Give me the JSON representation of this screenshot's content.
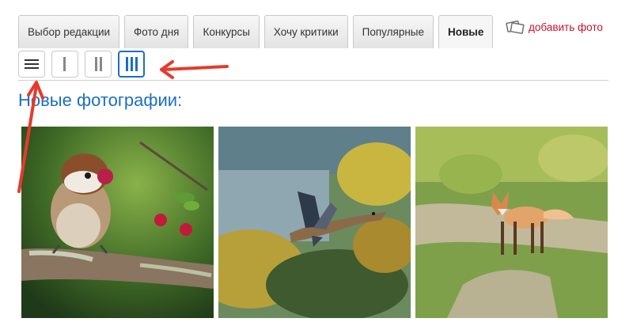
{
  "tabs": [
    {
      "label": "Выбор редакции",
      "active": false
    },
    {
      "label": "Фото дня",
      "active": false
    },
    {
      "label": "Конкурсы",
      "active": false
    },
    {
      "label": "Хочу критики",
      "active": false
    },
    {
      "label": "Популярные",
      "active": false
    },
    {
      "label": "Новые",
      "active": true
    }
  ],
  "add_photo": {
    "label": "добавить фото",
    "icon": "add-photo-icon",
    "color": "#c8102e"
  },
  "view_modes": [
    {
      "icon": "list-view-icon",
      "active": false
    },
    {
      "icon": "one-column-icon",
      "active": false
    },
    {
      "icon": "two-column-icon",
      "active": false
    },
    {
      "icon": "three-column-icon",
      "active": true
    }
  ],
  "section": {
    "title": "Новые фотографии:"
  },
  "photos": [
    {
      "subject": "sparrow-with-berry"
    },
    {
      "subject": "flying-duck"
    },
    {
      "subject": "fox-on-path"
    }
  ],
  "colors": {
    "accent": "#1b6fc2",
    "link": "#c8102e",
    "annotation_arrow": "#e53b2c"
  }
}
